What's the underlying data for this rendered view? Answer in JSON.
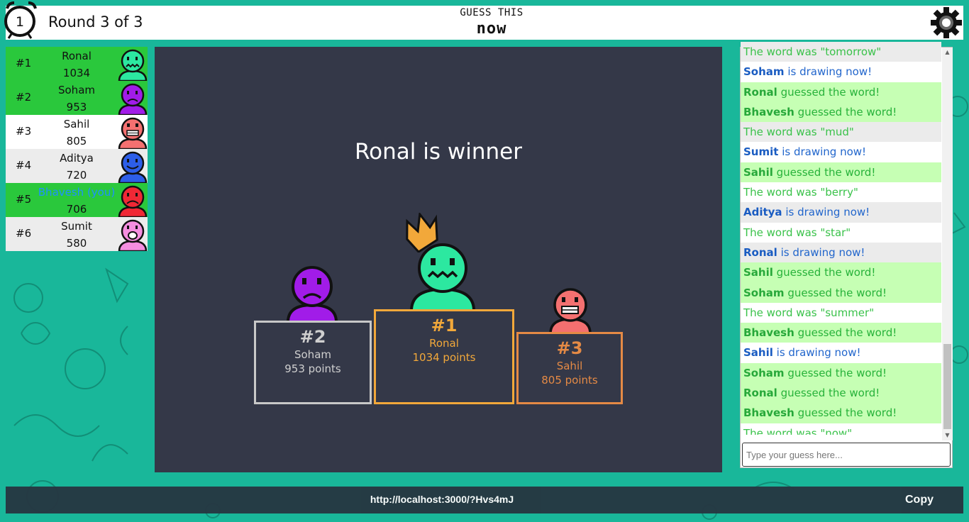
{
  "header": {
    "timer": "1",
    "round": "Round 3 of 3",
    "guess_label": "GUESS THIS",
    "guess_word": "now"
  },
  "players": [
    {
      "rank": "#1",
      "name": "Ronal",
      "score": "1034",
      "color": "#2ce8a0",
      "status": "guessed"
    },
    {
      "rank": "#2",
      "name": "Soham",
      "score": "953",
      "color": "#a11ce8",
      "status": "guessed"
    },
    {
      "rank": "#3",
      "name": "Sahil",
      "score": "805",
      "color": "#f47070",
      "status": "none"
    },
    {
      "rank": "#4",
      "name": "Aditya",
      "score": "720",
      "color": "#2d5ee8",
      "status": "alt"
    },
    {
      "rank": "#5",
      "name": "Bhavesh (you)",
      "score": "706",
      "color": "#f02835",
      "status": "guessed"
    },
    {
      "rank": "#6",
      "name": "Sumit",
      "score": "580",
      "color": "#f58ee0",
      "status": "alt"
    }
  ],
  "stage": {
    "winner_text": "Ronal is winner",
    "podium": [
      {
        "rank": "#2",
        "name": "Soham",
        "points": "953 points"
      },
      {
        "rank": "#1",
        "name": "Ronal",
        "points": "1034 points"
      },
      {
        "rank": "#3",
        "name": "Sahil",
        "points": "805 points"
      }
    ]
  },
  "chat": {
    "messages": [
      {
        "who": "",
        "text": "The word was \"tomorrow\"",
        "style": "gray lime-t"
      },
      {
        "who": "Soham",
        "text": " is drawing now!",
        "style": "white blue-t"
      },
      {
        "who": "Ronal",
        "text": " guessed the word!",
        "style": "green"
      },
      {
        "who": "Bhavesh",
        "text": " guessed the word!",
        "style": "green"
      },
      {
        "who": "",
        "text": "The word was \"mud\"",
        "style": "gray lime-t"
      },
      {
        "who": "Sumit",
        "text": " is drawing now!",
        "style": "white blue-t"
      },
      {
        "who": "Sahil",
        "text": " guessed the word!",
        "style": "green"
      },
      {
        "who": "",
        "text": "The word was \"berry\"",
        "style": "white lime-t"
      },
      {
        "who": "Aditya",
        "text": " is drawing now!",
        "style": "gray blue-t"
      },
      {
        "who": "",
        "text": "The word was \"star\"",
        "style": "white lime-t"
      },
      {
        "who": "Ronal",
        "text": " is drawing now!",
        "style": "gray blue-t"
      },
      {
        "who": "Sahil",
        "text": " guessed the word!",
        "style": "green"
      },
      {
        "who": "Soham",
        "text": " guessed the word!",
        "style": "green"
      },
      {
        "who": "",
        "text": "The word was \"summer\"",
        "style": "white lime-t"
      },
      {
        "who": "Bhavesh",
        "text": " guessed the word!",
        "style": "green"
      },
      {
        "who": "Sahil",
        "text": " is drawing now!",
        "style": "white blue-t"
      },
      {
        "who": "Soham",
        "text": " guessed the word!",
        "style": "green"
      },
      {
        "who": "Ronal",
        "text": " guessed the word!",
        "style": "green"
      },
      {
        "who": "Bhavesh",
        "text": " guessed the word!",
        "style": "green"
      },
      {
        "who": "",
        "text": "The word was \"now\"",
        "style": "white lime-t"
      }
    ],
    "input_placeholder": "Type your guess here..."
  },
  "footer": {
    "invite_url": "http://localhost:3000/?Hvs4mJ",
    "copy_label": "Copy"
  },
  "colors": {
    "background": "#19b79a",
    "guessed_row": "#2ac83c",
    "stage_bg": "#343848",
    "gold": "#f2a83a",
    "silver": "#c8c8c8",
    "bronze": "#e58a45"
  }
}
